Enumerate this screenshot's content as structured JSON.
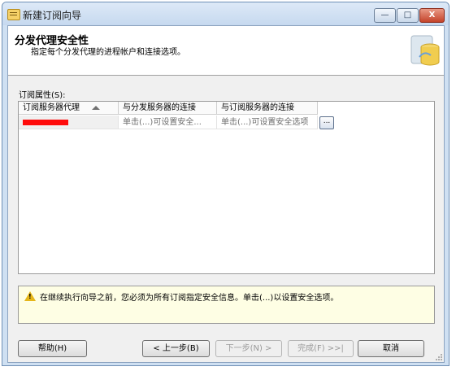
{
  "window": {
    "title": "新建订阅向导",
    "minimize": "—",
    "maximize": "□",
    "close": "X"
  },
  "header": {
    "title": "分发代理安全性",
    "subtitle": "指定每个分发代理的进程帐户和连接选项。"
  },
  "grid": {
    "label": "订阅属性(S):",
    "columns": [
      "订阅服务器代理",
      "与分发服务器的连接",
      "与订阅服务器的连接"
    ],
    "row": {
      "agent": "",
      "distributor_conn": "单击(...)可设置安全...",
      "subscriber_conn": "单击(...)可设置安全选项"
    },
    "ellipsis": "..."
  },
  "warning": {
    "text": "在继续执行向导之前，您必须为所有订阅指定安全信息。单击(...)以设置安全选项。"
  },
  "buttons": {
    "help": "帮助(H)",
    "back": "< 上一步(B)",
    "next": "下一步(N) >",
    "finish": "完成(F) >>|",
    "cancel": "取消"
  }
}
